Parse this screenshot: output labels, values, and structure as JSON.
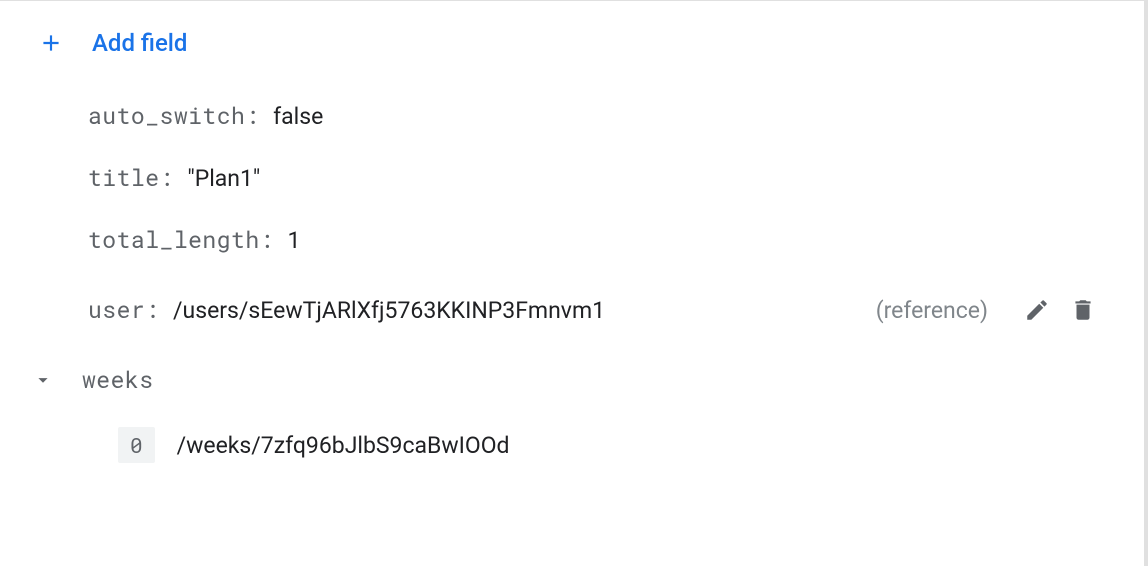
{
  "add_field_label": "Add field",
  "fields": {
    "auto_switch": {
      "key": "auto_switch",
      "value": "false"
    },
    "title": {
      "key": "title",
      "value": "\"Plan1\""
    },
    "total_length": {
      "key": "total_length",
      "value": "1"
    },
    "user": {
      "key": "user",
      "value": "/users/sEewTjARlXfj5763KKINP3Fmnvm1",
      "type": "(reference)"
    },
    "weeks": {
      "key": "weeks",
      "items": [
        {
          "index": "0",
          "value": "/weeks/7zfq96bJlbS9caBwIOOd"
        }
      ]
    }
  }
}
